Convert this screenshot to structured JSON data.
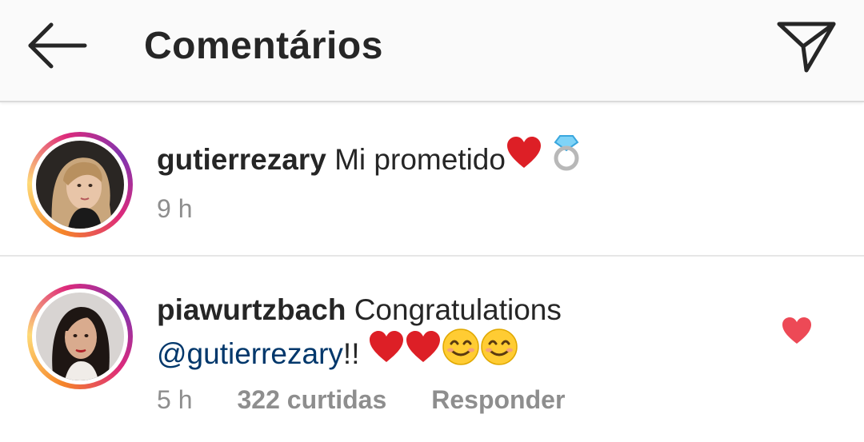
{
  "header": {
    "title": "Comentários"
  },
  "comments": [
    {
      "username": "gutierrezary",
      "text": "Mi prometido",
      "emojis": [
        "red-heart",
        "ring"
      ],
      "time": "9 h"
    },
    {
      "username": "piawurtzbach",
      "text": "Congratulations",
      "mention": "@gutierrezary",
      "text_after": "!!",
      "emojis": [
        "red-heart",
        "red-heart",
        "smiling-face",
        "smiling-face"
      ],
      "time": "5 h",
      "likes": "322 curtidas",
      "reply_label": "Responder",
      "liked": true
    }
  ],
  "colors": {
    "heart": "#ed4956",
    "mention": "#00376b",
    "meta": "#8e8e8e",
    "text": "#262626"
  }
}
